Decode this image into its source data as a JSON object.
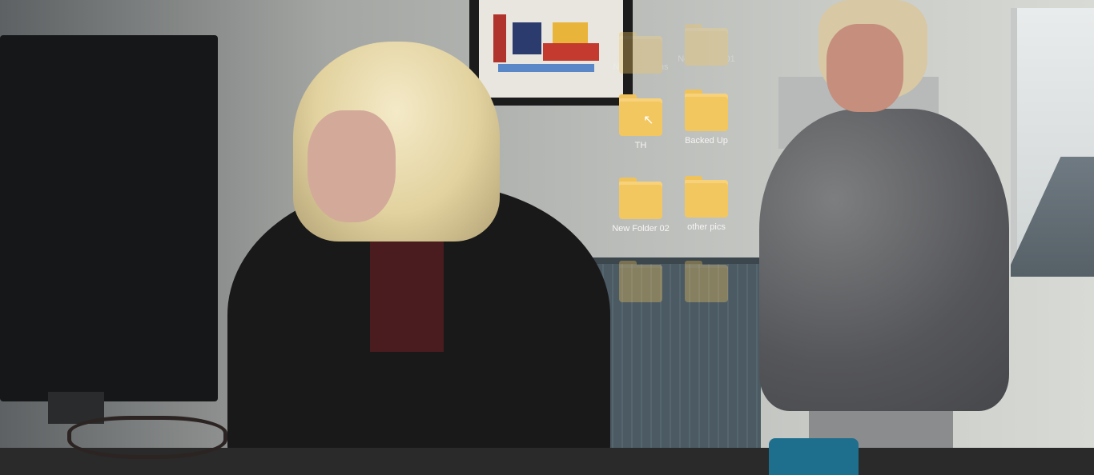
{
  "folders": [
    {
      "label": "New Uniforms"
    },
    {
      "label": "New Folder 01"
    },
    {
      "label": "TH"
    },
    {
      "label": "Backed Up"
    },
    {
      "label": "New Folder 02"
    },
    {
      "label": "other pics"
    },
    {
      "label": ""
    },
    {
      "label": ""
    }
  ],
  "icons": {
    "folder": "folder-icon",
    "cursor": "mouse-cursor-icon"
  },
  "colors": {
    "folder": "#f3c760",
    "label": "#f6f6f4"
  }
}
